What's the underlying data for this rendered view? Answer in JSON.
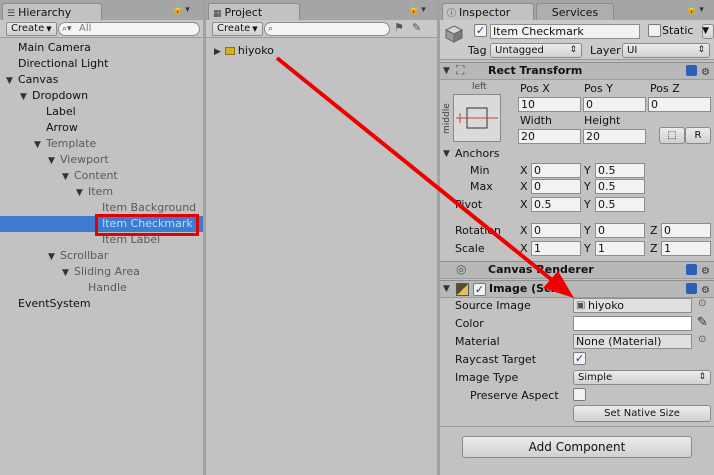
{
  "hierarchy": {
    "tab_label": "Hierarchy",
    "create_label": "Create",
    "search_placeholder": "All",
    "items": [
      {
        "label": "Main Camera",
        "indent": 0,
        "arrow": "",
        "dim": false
      },
      {
        "label": "Directional Light",
        "indent": 0,
        "arrow": "",
        "dim": false
      },
      {
        "label": "Canvas",
        "indent": 0,
        "arrow": "▼",
        "dim": false
      },
      {
        "label": "Dropdown",
        "indent": 1,
        "arrow": "▼",
        "dim": false
      },
      {
        "label": "Label",
        "indent": 2,
        "arrow": "",
        "dim": false
      },
      {
        "label": "Arrow",
        "indent": 2,
        "arrow": "",
        "dim": false
      },
      {
        "label": "Template",
        "indent": 2,
        "arrow": "▼",
        "dim": true
      },
      {
        "label": "Viewport",
        "indent": 3,
        "arrow": "▼",
        "dim": true
      },
      {
        "label": "Content",
        "indent": 4,
        "arrow": "▼",
        "dim": true
      },
      {
        "label": "Item",
        "indent": 5,
        "arrow": "▼",
        "dim": true
      },
      {
        "label": "Item Background",
        "indent": 6,
        "arrow": "",
        "dim": true
      },
      {
        "label": "Item Checkmark",
        "indent": 6,
        "arrow": "",
        "dim": false,
        "selected": true
      },
      {
        "label": "Item Label",
        "indent": 6,
        "arrow": "",
        "dim": true
      },
      {
        "label": "Scrollbar",
        "indent": 3,
        "arrow": "▼",
        "dim": true
      },
      {
        "label": "Sliding Area",
        "indent": 4,
        "arrow": "▼",
        "dim": true
      },
      {
        "label": "Handle",
        "indent": 5,
        "arrow": "",
        "dim": true
      },
      {
        "label": "EventSystem",
        "indent": 0,
        "arrow": "",
        "dim": false
      }
    ]
  },
  "project": {
    "tab_label": "Project",
    "create_label": "Create",
    "folder_label": "hiyoko"
  },
  "inspector": {
    "tab_label": "Inspector",
    "services_tab": "Services",
    "object_name": "Item Checkmark",
    "static_label": "Static",
    "tag_label": "Tag",
    "tag_value": "Untagged",
    "layer_label": "Layer",
    "layer_value": "UI",
    "rect_transform": {
      "title": "Rect Transform",
      "anchor_h": "left",
      "anchor_v": "middle",
      "posx_label": "Pos X",
      "posy_label": "Pos Y",
      "posz_label": "Pos Z",
      "posx": "10",
      "posy": "0",
      "posz": "0",
      "width_label": "Width",
      "height_label": "Height",
      "width": "20",
      "height": "20",
      "r_button": "R",
      "anchors_label": "Anchors",
      "min_label": "Min",
      "max_label": "Max",
      "min_x": "0",
      "min_y": "0.5",
      "max_x": "0",
      "max_y": "0.5",
      "pivot_label": "Pivot",
      "pivot_x": "0.5",
      "pivot_y": "0.5",
      "rotation_label": "Rotation",
      "rot_x": "0",
      "rot_y": "0",
      "rot_z": "0",
      "scale_label": "Scale",
      "scale_x": "1",
      "scale_y": "1",
      "scale_z": "1",
      "x": "X",
      "y": "Y",
      "z": "Z"
    },
    "canvas_renderer": {
      "title": "Canvas Renderer"
    },
    "image": {
      "title": "Image (Scr",
      "source_image_label": "Source Image",
      "source_image_value": "hiyoko",
      "color_label": "Color",
      "material_label": "Material",
      "material_value": "None (Material)",
      "raycast_label": "Raycast Target",
      "image_type_label": "Image Type",
      "image_type_value": "Simple",
      "preserve_label": "Preserve Aspect",
      "native_size_button": "Set Native Size"
    },
    "add_component": "Add Component"
  },
  "colors": {
    "selection": "#3e7bd1",
    "highlight_box": "#e40000",
    "arrow": "#ee0000"
  }
}
